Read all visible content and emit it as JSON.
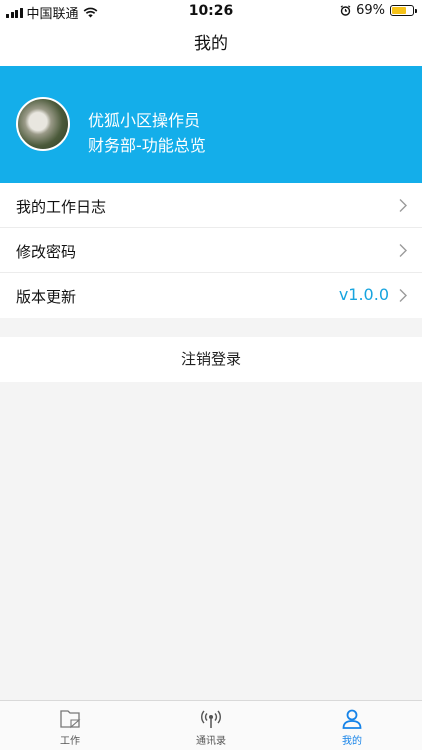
{
  "status_bar": {
    "carrier": "中国联通",
    "time": "10:26",
    "battery_percent": "69%",
    "battery_level": 0.69
  },
  "nav": {
    "title": "我的"
  },
  "profile": {
    "name": "优狐小区操作员",
    "department": "财务部-功能总览",
    "background_color": "#14aeea"
  },
  "menu": {
    "items": [
      {
        "label": "我的工作日志"
      },
      {
        "label": "修改密码"
      },
      {
        "label": "版本更新",
        "value": "v1.0.0"
      }
    ]
  },
  "logout": {
    "label": "注销登录"
  },
  "tabs": [
    {
      "label": "工作",
      "icon": "folder-icon",
      "active": false
    },
    {
      "label": "通讯录",
      "icon": "antenna-icon",
      "active": false
    },
    {
      "label": "我的",
      "icon": "person-icon",
      "active": true
    }
  ],
  "accent_color": "#1683e8"
}
